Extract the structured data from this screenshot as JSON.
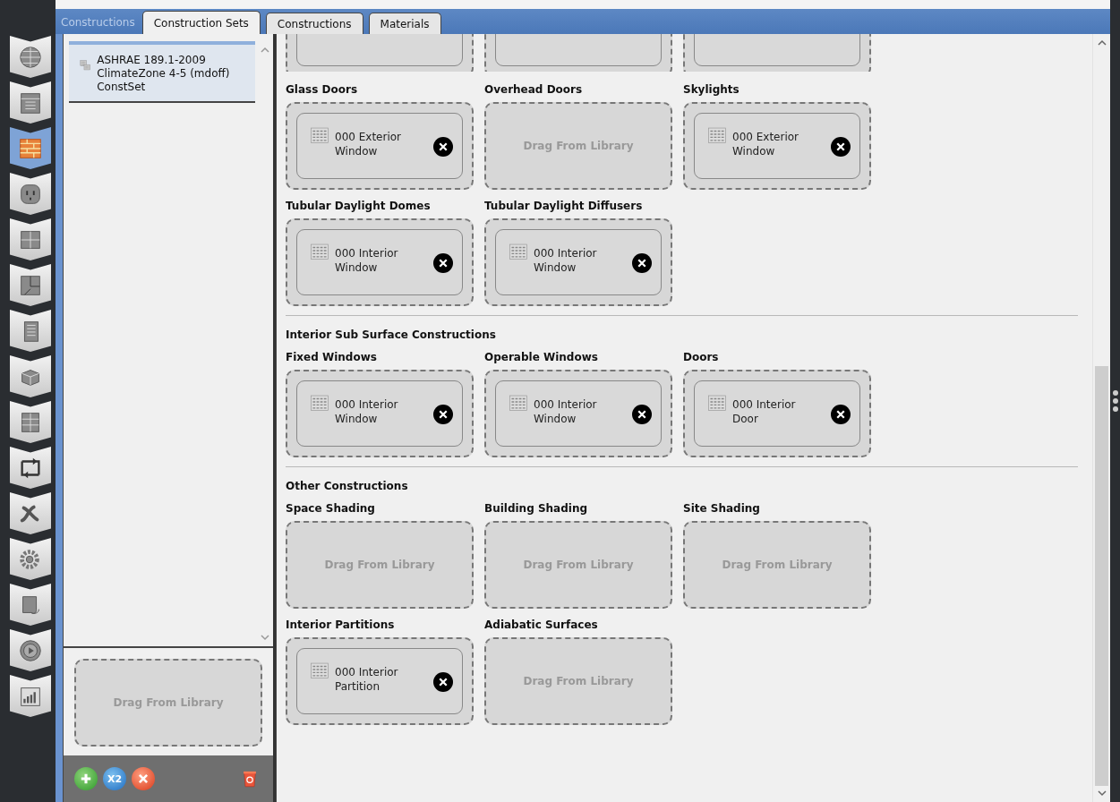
{
  "nav": [
    {
      "selected": false
    },
    {
      "selected": false
    },
    {
      "selected": true
    },
    {
      "selected": false
    },
    {
      "selected": false
    },
    {
      "selected": false
    },
    {
      "selected": false
    },
    {
      "selected": false
    },
    {
      "selected": false
    },
    {
      "selected": false
    },
    {
      "selected": false
    },
    {
      "selected": false
    },
    {
      "selected": false
    },
    {
      "selected": false
    },
    {
      "selected": false
    }
  ],
  "header_label": "Constructions",
  "tabs": [
    {
      "label": "Construction Sets",
      "selected": true
    },
    {
      "label": "Constructions",
      "selected": false
    },
    {
      "label": "Materials",
      "selected": false
    }
  ],
  "construction_sets": {
    "items": [
      {
        "name": "ASHRAE 189.1-2009 ClimateZone 4-5 (mdoff) ConstSet",
        "selected": true
      }
    ],
    "drop_zone": "Drag From Library",
    "copy_label": "X2"
  },
  "partial_row": [
    {
      "kind": "filled"
    },
    {
      "kind": "filled"
    },
    {
      "kind": "filled"
    }
  ],
  "sections": [
    {
      "rows": [
        [
          {
            "label": "Glass Doors",
            "kind": "filled",
            "construction": "000 Exterior Window"
          },
          {
            "label": "Overhead Doors",
            "kind": "empty",
            "hint": "Drag From Library"
          },
          {
            "label": "Skylights",
            "kind": "filled",
            "construction": "000 Exterior Window"
          }
        ],
        [
          {
            "label": "Tubular Daylight Domes",
            "kind": "filled",
            "construction": "000 Interior Window"
          },
          {
            "label": "Tubular Daylight Diffusers",
            "kind": "filled",
            "construction": "000 Interior Window"
          }
        ]
      ]
    },
    {
      "heading": "Interior Sub Surface Constructions",
      "rows": [
        [
          {
            "label": "Fixed Windows",
            "kind": "filled",
            "construction": "000 Interior Window"
          },
          {
            "label": "Operable Windows",
            "kind": "filled",
            "construction": "000 Interior Window"
          },
          {
            "label": "Doors",
            "kind": "filled",
            "construction": "000 Interior Door"
          }
        ]
      ]
    },
    {
      "heading": "Other Constructions",
      "rows": [
        [
          {
            "label": "Space Shading",
            "kind": "empty",
            "hint": "Drag From Library"
          },
          {
            "label": "Building Shading",
            "kind": "empty",
            "hint": "Drag From Library"
          },
          {
            "label": "Site Shading",
            "kind": "empty",
            "hint": "Drag From Library"
          }
        ],
        [
          {
            "label": "Interior Partitions",
            "kind": "filled",
            "construction": "000 Interior Partition"
          },
          {
            "label": "Adiabatic Surfaces",
            "kind": "empty",
            "hint": "Drag From Library"
          }
        ]
      ]
    }
  ]
}
